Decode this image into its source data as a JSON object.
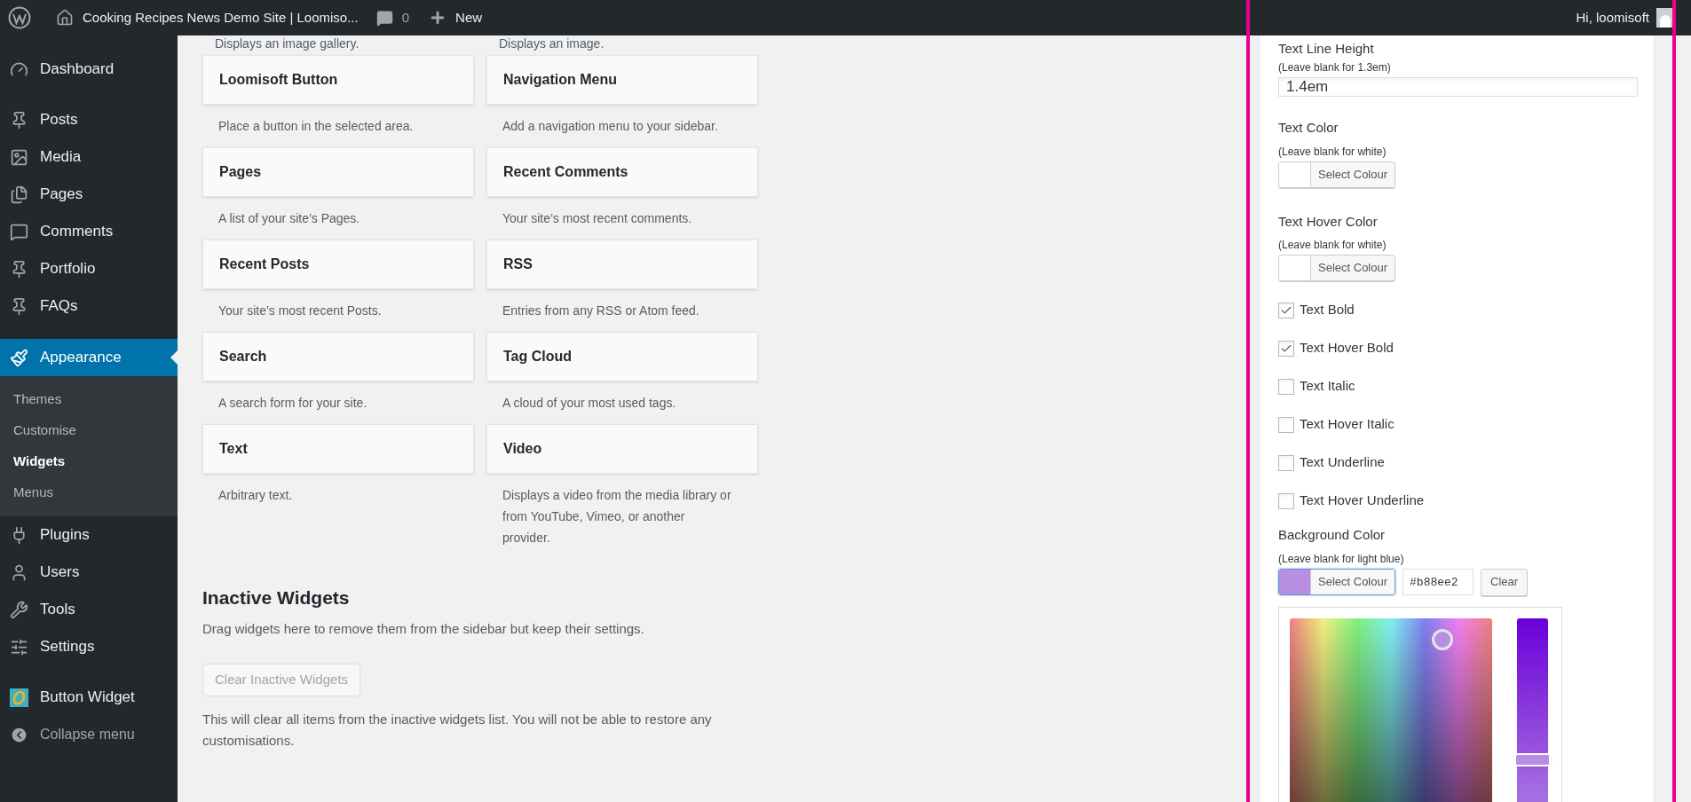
{
  "admin_bar": {
    "site_title": "Cooking Recipes News Demo Site | Loomiso...",
    "comments_count": "0",
    "new_label": "New",
    "greeting": "Hi, loomisoft"
  },
  "sidebar": {
    "items": [
      {
        "label": "Dashboard",
        "selected": false
      },
      {
        "label": "Posts",
        "selected": false
      },
      {
        "label": "Media",
        "selected": false
      },
      {
        "label": "Pages",
        "selected": false
      },
      {
        "label": "Comments",
        "selected": false
      },
      {
        "label": "Portfolio",
        "selected": false
      },
      {
        "label": "FAQs",
        "selected": false
      },
      {
        "label": "Appearance",
        "selected": true,
        "children": [
          {
            "label": "Themes",
            "selected": false
          },
          {
            "label": "Customise",
            "selected": false
          },
          {
            "label": "Widgets",
            "selected": true
          },
          {
            "label": "Menus",
            "selected": false
          }
        ]
      },
      {
        "label": "Plugins",
        "selected": false
      },
      {
        "label": "Users",
        "selected": false
      },
      {
        "label": "Tools",
        "selected": false
      },
      {
        "label": "Settings",
        "selected": false
      },
      {
        "label": "Button Widget",
        "selected": false
      }
    ],
    "collapse_label": "Collapse menu"
  },
  "available_widgets": {
    "cut_descriptions": [
      "Displays an image gallery.",
      "Displays an image."
    ],
    "widgets": [
      {
        "title": "Loomisoft Button",
        "description": "Place a button in the selected area."
      },
      {
        "title": "Navigation Menu",
        "description": "Add a navigation menu to your sidebar."
      },
      {
        "title": "Pages",
        "description": "A list of your site’s Pages."
      },
      {
        "title": "Recent Comments",
        "description": "Your site’s most recent comments."
      },
      {
        "title": "Recent Posts",
        "description": "Your site’s most recent Posts."
      },
      {
        "title": "RSS",
        "description": "Entries from any RSS or Atom feed."
      },
      {
        "title": "Search",
        "description": "A search form for your site."
      },
      {
        "title": "Tag Cloud",
        "description": "A cloud of your most used tags."
      },
      {
        "title": "Text",
        "description": "Arbitrary text."
      },
      {
        "title": "Video",
        "description": "Displays a video from the media library or from YouTube, Vimeo, or another provider."
      }
    ]
  },
  "inactive_widgets": {
    "heading": "Inactive Widgets",
    "text": "Drag widgets here to remove them from the sidebar but keep their settings.",
    "button": {
      "label": "Clear Inactive Widgets",
      "disabled": true
    },
    "note": "This will clear all items from the inactive widgets list. You will not be able to restore any customisations."
  },
  "settings_panel": {
    "line_height": {
      "label": "Text Line Height",
      "hint": "(Leave blank for 1.3em)",
      "value": "1.4em"
    },
    "text_color": {
      "label": "Text Color",
      "hint": "(Leave blank for white)",
      "button": "Select Colour"
    },
    "text_hover_color": {
      "label": "Text Hover Color",
      "hint": "(Leave blank for white)",
      "button": "Select Colour"
    },
    "checkboxes": [
      {
        "label": "Text Bold",
        "checked": true
      },
      {
        "label": "Text Hover Bold",
        "checked": true
      },
      {
        "label": "Text Italic",
        "checked": false
      },
      {
        "label": "Text Hover Italic",
        "checked": false
      },
      {
        "label": "Text Underline",
        "checked": false
      },
      {
        "label": "Text Hover Underline",
        "checked": false
      }
    ],
    "background_color": {
      "label": "Background Color",
      "hint": "(Leave blank for light blue)",
      "button": "Select Colour",
      "value": "#b88ee2",
      "clear": "Clear",
      "slider": {
        "level": 0.58
      }
    }
  }
}
